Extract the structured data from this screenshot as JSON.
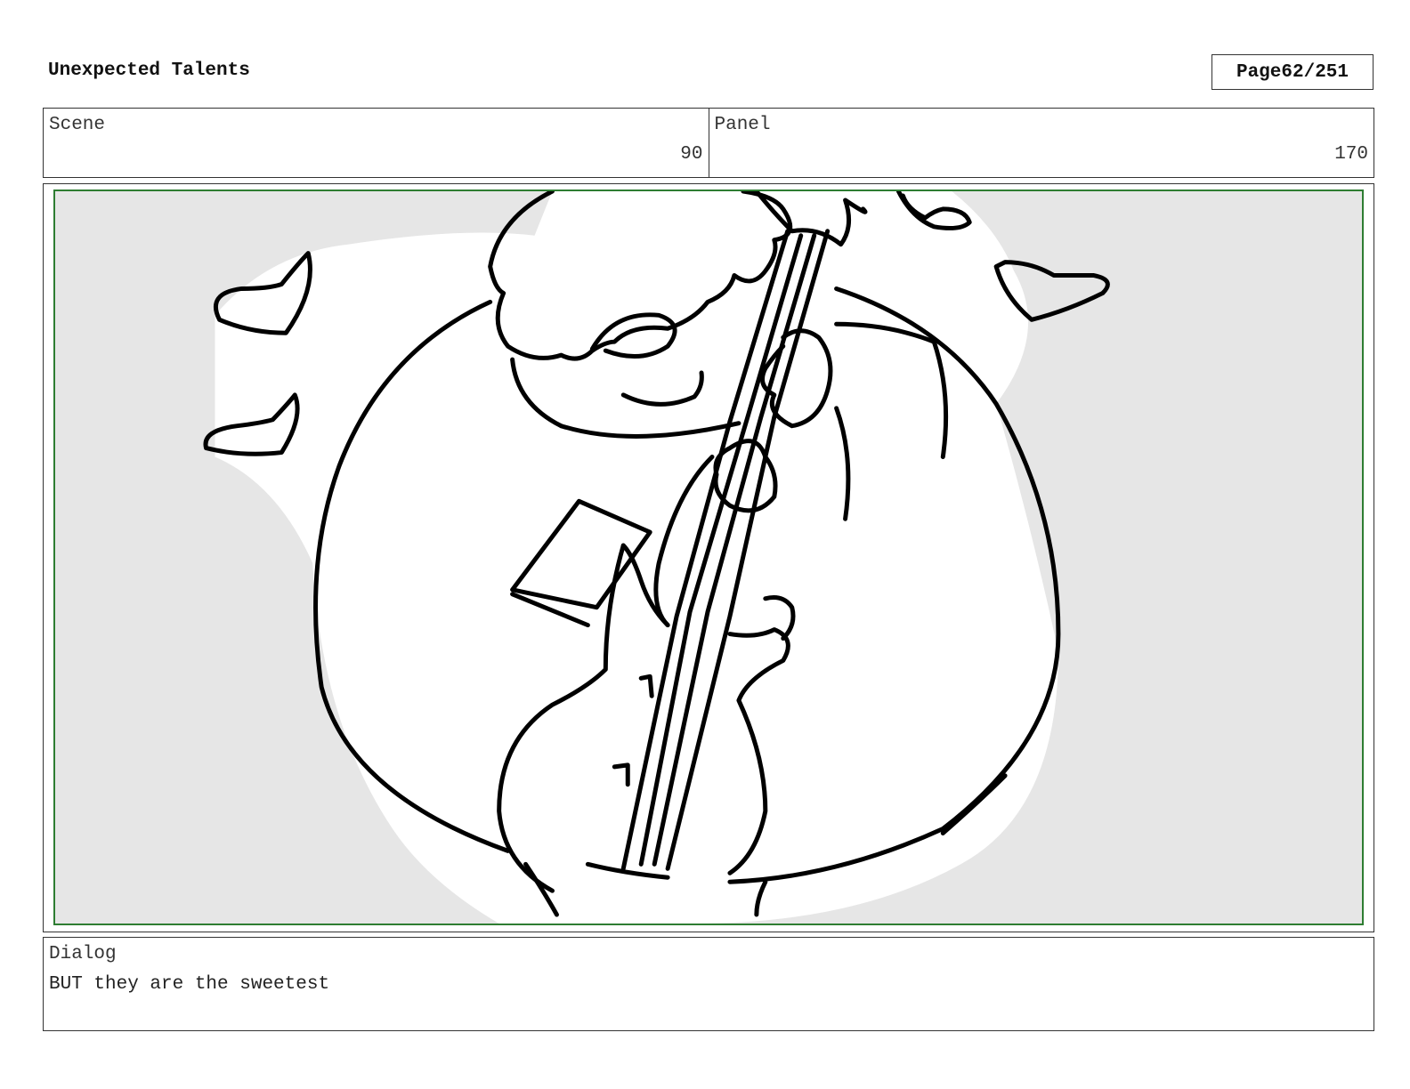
{
  "document": {
    "title": "Unexpected Talents",
    "page_label": "Page",
    "page_number": "62/251"
  },
  "meta": {
    "scene_label": "Scene",
    "scene_value": "90",
    "panel_label": "Panel",
    "panel_value": "170"
  },
  "dialog": {
    "label": "Dialog",
    "text": "BUT they are the sweetest"
  },
  "colors": {
    "frame_border": "#2e7d32",
    "panel_background": "#e6e6e6",
    "ink": "#000000"
  }
}
